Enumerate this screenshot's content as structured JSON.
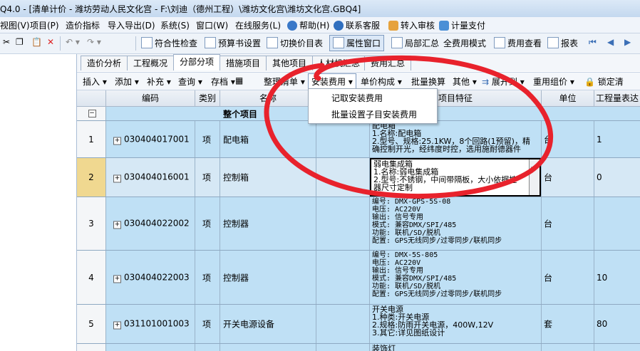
{
  "window": {
    "title": "Q4.0 - [清单计价 - 潍坊劳动人民文化宫 - F:\\刘迪（德州工程）\\潍坊文化宫\\潍坊文化宫.GBQ4]"
  },
  "menubar": {
    "items": [
      "视图(V)",
      "项目(P)",
      "造价指标",
      "导入导出(D)",
      "系统(S)",
      "窗口(W)",
      "在线服务(L)",
      "帮助(H)",
      "联系客服",
      "转入审核",
      "计量支付"
    ]
  },
  "toolbar": {
    "buttons": [
      "符合性检查",
      "预算书设置",
      "切换价目表",
      "属性窗口",
      "局部汇总",
      "全费用模式",
      "费用查看",
      "报表"
    ]
  },
  "tabs": [
    "造价分析",
    "工程概况",
    "分部分项",
    "措施项目",
    "其他项目",
    "人材机汇总",
    "费用汇总"
  ],
  "active_tab": "分部分项",
  "operations": [
    "插入",
    "添加",
    "补充",
    "查询",
    "存档",
    "整理清单",
    "安装费用",
    "单价构成",
    "批量换算",
    "其他",
    "展开到",
    "重用组价",
    "锁定清"
  ],
  "dropdown": {
    "items": [
      "记取安装费用",
      "批量设置子目安装费用"
    ]
  },
  "table": {
    "columns": [
      "编码",
      "类别",
      "名称",
      "项目特征",
      "单位",
      "工程量表达"
    ],
    "group_row_label": "整个项目",
    "rows": [
      {
        "index": "1",
        "code": "030404017001",
        "type": "项",
        "name": "配电箱",
        "features": [
          "配电箱",
          "1.名称:配电箱",
          "2.型号、规格:25.1KW，8个回路(1预留)，精",
          "确控制开光，经纬度时控，选用施耐德器件"
        ],
        "unit": "台",
        "qty": "1"
      },
      {
        "index": "2",
        "code": "030404016001",
        "type": "项",
        "name": "控制箱",
        "features": [
          "弱电集成箱",
          "1.名称:弱电集成箱",
          "2.型号:不锈钢，中间带隔板，大小依据控",
          "器尺寸定制"
        ],
        "unit": "台",
        "qty": "0"
      },
      {
        "index": "3",
        "code": "030404022002",
        "type": "项",
        "name": "控制器",
        "features": [
          "编号: DMX-GPS-5S-08",
          "电压: AC220V",
          "输出: 信号专用",
          "模式: 兼容DMX/SPI/485",
          "功能: 联机/SD/脱机",
          "配置: GPS无线同步/过零同步/联机同步"
        ],
        "unit": "台",
        "qty": ""
      },
      {
        "index": "4",
        "code": "030404022003",
        "type": "项",
        "name": "控制器",
        "features": [
          "编号: DMX-5S-805",
          "电压: AC220V",
          "输出: 信号专用",
          "模式: 兼容DMX/SPI/485",
          "功能: 联机/SD/脱机",
          "配置: GPS无线同步/过零同步/联机同步"
        ],
        "unit": "台",
        "qty": "10"
      },
      {
        "index": "5",
        "code": "031101001003",
        "type": "项",
        "name": "开关电源设备",
        "features": [
          "开关电源",
          "1.种类:开关电源",
          "2.规格:防雨开关电源，400W,12V",
          "3.其它:详见图纸设计"
        ],
        "unit": "套",
        "qty": "80"
      },
      {
        "index": "",
        "code": "",
        "type": "",
        "name": "",
        "features": [
          "装饰灯"
        ],
        "unit": "",
        "qty": ""
      }
    ]
  },
  "colors": {
    "row_bg": "#bfe0f5",
    "annotation_stroke": "#e8222c"
  }
}
